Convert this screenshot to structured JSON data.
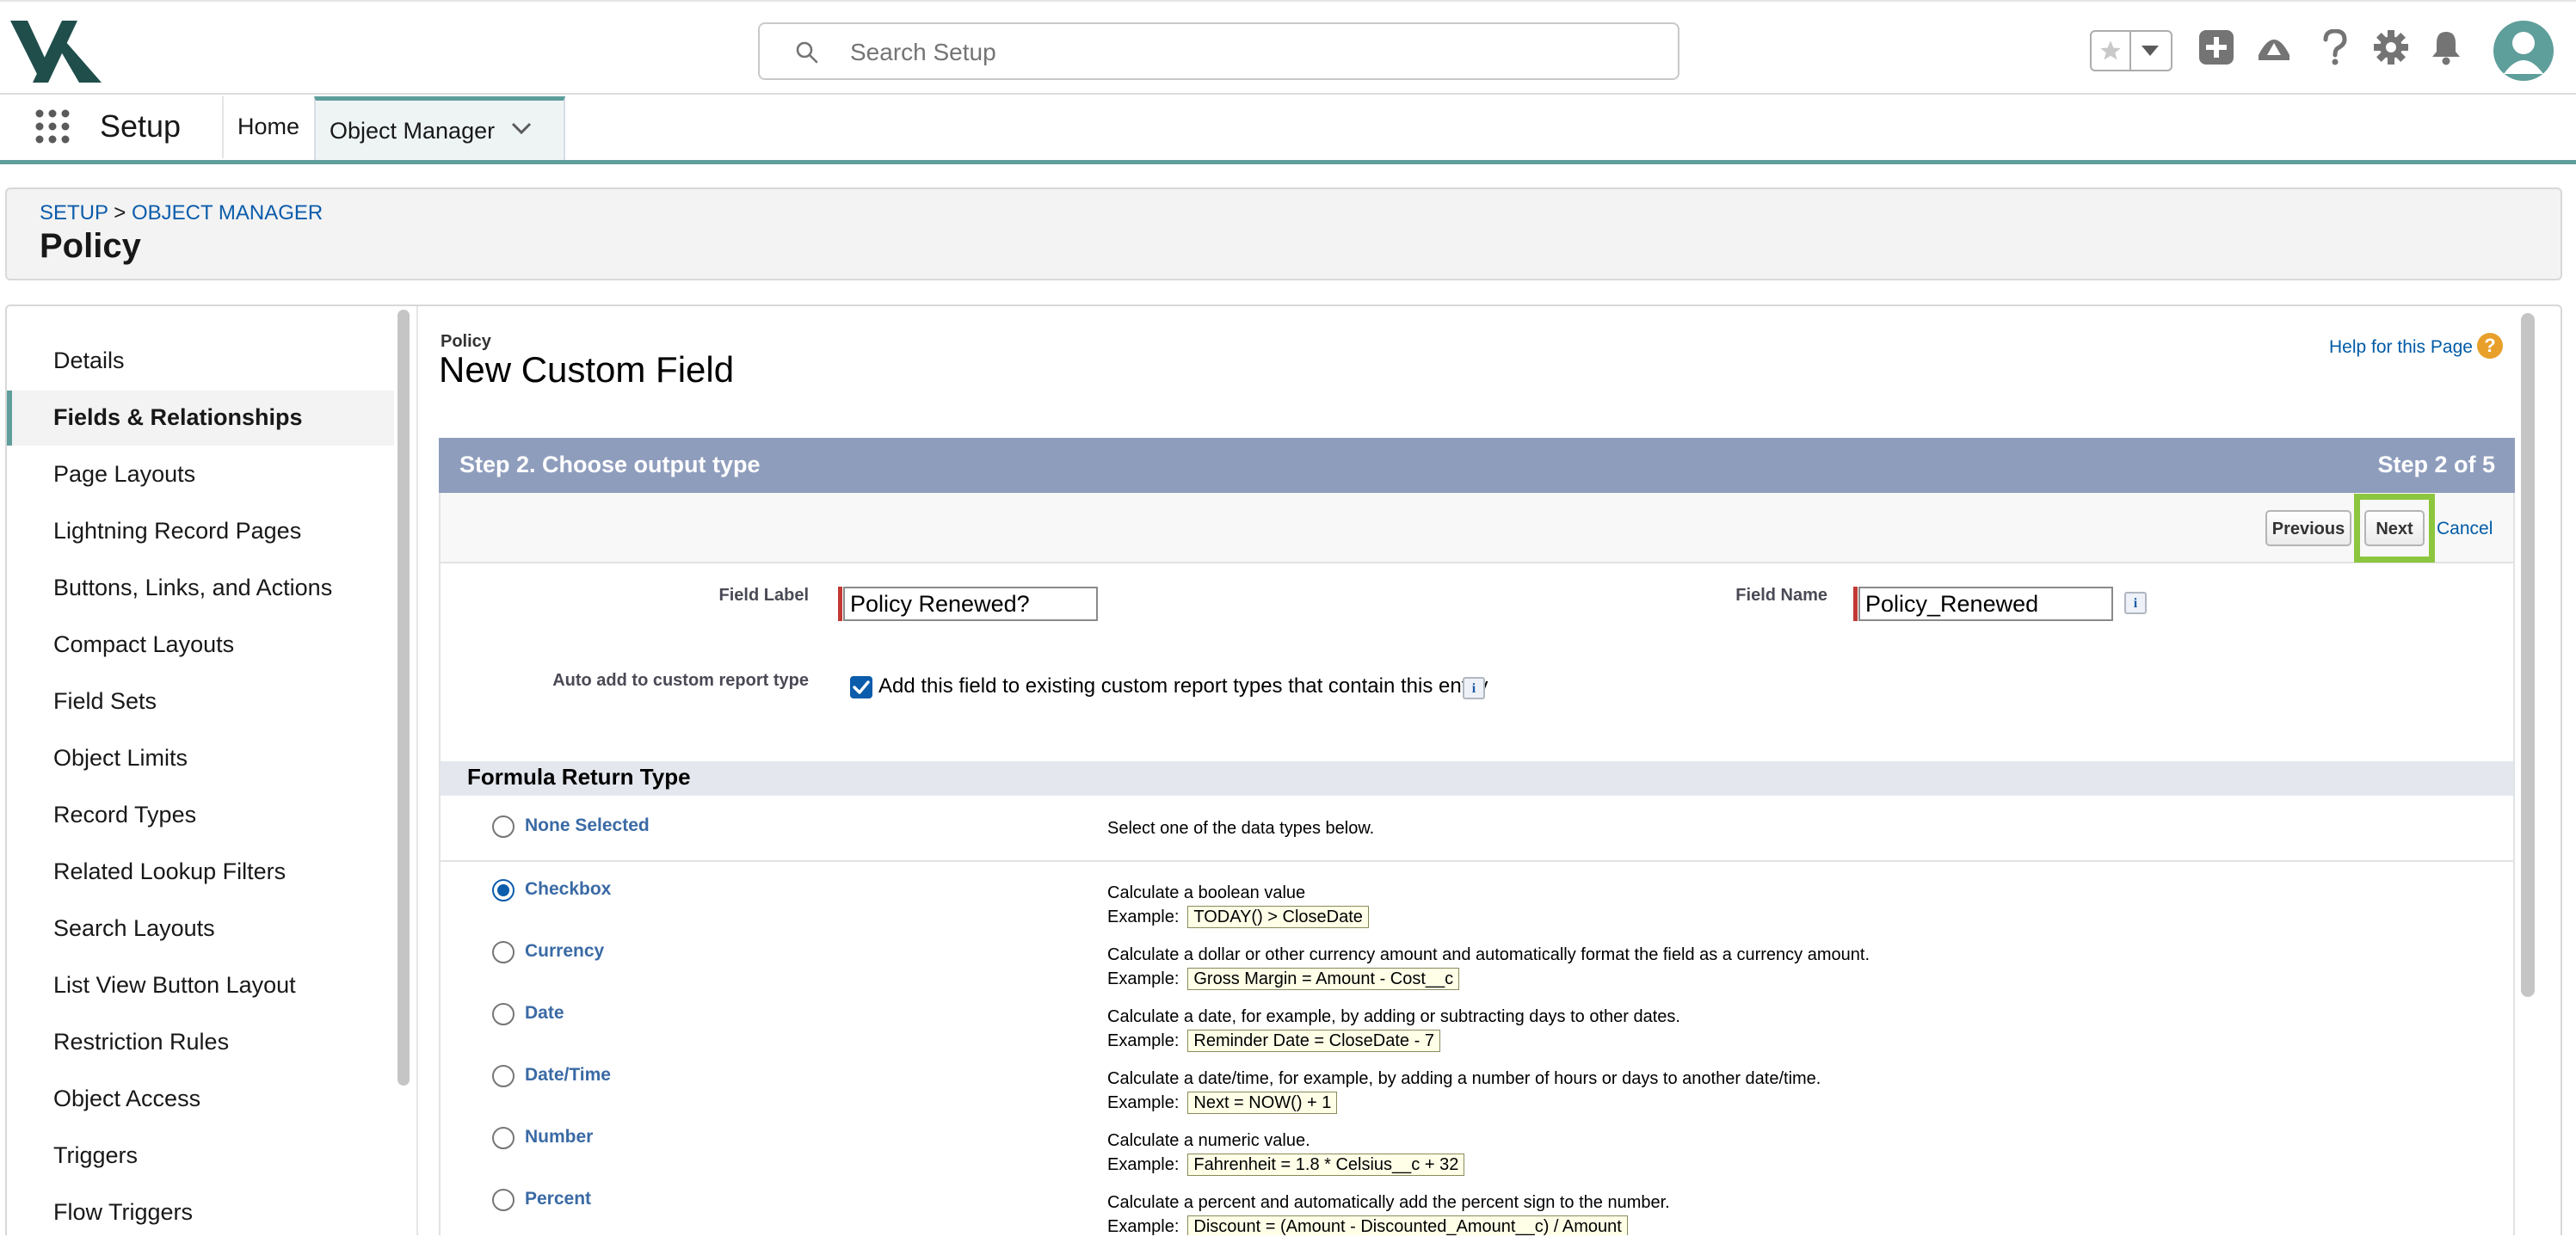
{
  "header": {
    "search_placeholder": "Search Setup",
    "icons": [
      "logo",
      "search-icon",
      "star-icon",
      "chevron-down-icon",
      "plus-icon",
      "trailhead-icon",
      "help-icon",
      "gear-icon",
      "bell-icon",
      "avatar-icon"
    ]
  },
  "appnav": {
    "app_name": "Setup",
    "tabs": [
      {
        "label": "Home"
      },
      {
        "label": "Object Manager"
      }
    ]
  },
  "breadcrumb": {
    "setup": "SETUP",
    "separator": ">",
    "object_manager": "OBJECT MANAGER",
    "title": "Policy"
  },
  "sidebar": {
    "items": [
      {
        "label": "Details"
      },
      {
        "label": "Fields & Relationships"
      },
      {
        "label": "Page Layouts"
      },
      {
        "label": "Lightning Record Pages"
      },
      {
        "label": "Buttons, Links, and Actions"
      },
      {
        "label": "Compact Layouts"
      },
      {
        "label": "Field Sets"
      },
      {
        "label": "Object Limits"
      },
      {
        "label": "Record Types"
      },
      {
        "label": "Related Lookup Filters"
      },
      {
        "label": "Search Layouts"
      },
      {
        "label": "List View Button Layout"
      },
      {
        "label": "Restriction Rules"
      },
      {
        "label": "Object Access"
      },
      {
        "label": "Triggers"
      },
      {
        "label": "Flow Triggers"
      }
    ],
    "active_index": 1
  },
  "content": {
    "object_label": "Policy",
    "title": "New Custom Field",
    "help_link": "Help for this Page",
    "help_icon": "?",
    "step_title": "Step 2. Choose output type",
    "step_count": "Step 2 of 5",
    "buttons": {
      "previous": "Previous",
      "next": "Next",
      "cancel": "Cancel"
    },
    "form": {
      "field_label_label": "Field Label",
      "field_label_value": "Policy Renewed?",
      "field_name_label": "Field Name",
      "field_name_value": "Policy_Renewed",
      "info_glyph": "i",
      "auto_add_label": "Auto add to custom report type",
      "auto_add_checked": true,
      "auto_add_text": "Add this field to existing custom report types that contain this entity"
    },
    "formula_return_type": {
      "title": "Formula Return Type",
      "example_label": "Example:",
      "types": [
        {
          "name": "None Selected",
          "desc": "Select one of the data types below.",
          "example": "",
          "selected": false
        },
        {
          "name": "Checkbox",
          "desc": "Calculate a boolean value",
          "example": "TODAY() > CloseDate",
          "selected": true
        },
        {
          "name": "Currency",
          "desc": "Calculate a dollar or other currency amount and automatically format the field as a currency amount.",
          "example": "Gross Margin = Amount - Cost__c",
          "selected": false
        },
        {
          "name": "Date",
          "desc": "Calculate a date, for example, by adding or subtracting days to other dates.",
          "example": "Reminder Date = CloseDate - 7",
          "selected": false
        },
        {
          "name": "Date/Time",
          "desc": "Calculate a date/time, for example, by adding a number of hours or days to another date/time.",
          "example": "Next = NOW() + 1",
          "selected": false
        },
        {
          "name": "Number",
          "desc": "Calculate a numeric value.",
          "example": "Fahrenheit = 1.8 * Celsius__c + 32",
          "selected": false
        },
        {
          "name": "Percent",
          "desc": "Calculate a percent and automatically add the percent sign to the number.",
          "example": "Discount = (Amount - Discounted_Amount__c) / Amount",
          "selected": false
        }
      ]
    }
  },
  "colors": {
    "accent": "#5e9e9b",
    "link": "#0b5cab",
    "step_bar": "#8f9dbd",
    "highlight": "#8cc63f",
    "required": "#c23934"
  }
}
